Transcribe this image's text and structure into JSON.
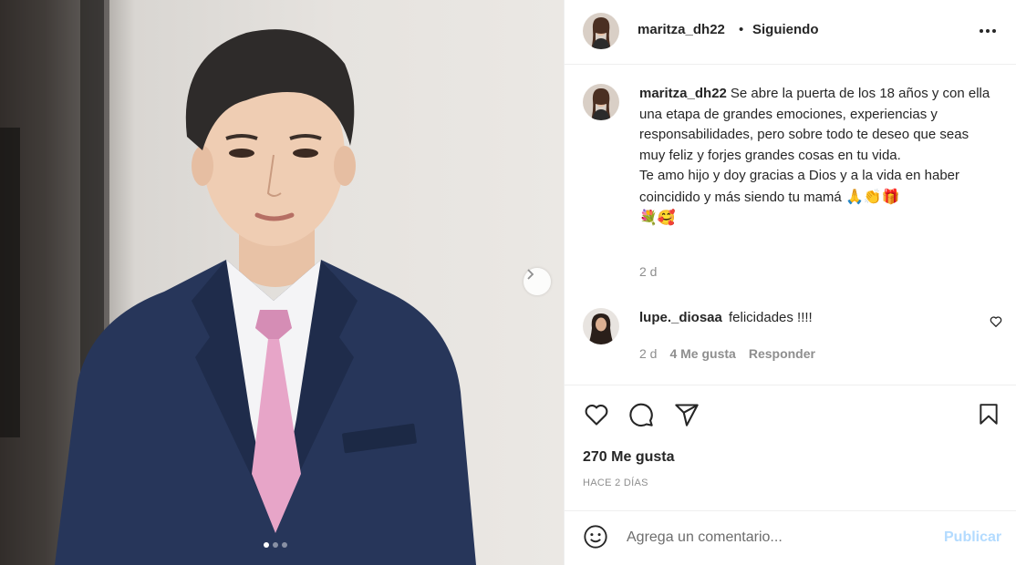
{
  "post": {
    "author": "maritza_dh22",
    "separator": "•",
    "follow_status": "Siguiendo",
    "more_icon": "more-horizontal-icon",
    "carousel": {
      "total_slides": 3,
      "active_slide": 1
    }
  },
  "caption": {
    "username": "maritza_dh22",
    "text": "Se abre la puerta de los 18 años y con ella una etapa de grandes emociones, experiencias y responsabilidades, pero sobre todo te deseo que seas muy feliz y forjes grandes cosas en tu vida.",
    "text2": "Te amo hijo y doy gracias a Dios y a la vida en haber coincidido y más siendo tu mamá",
    "emojis_line1": "🙏👏🎁",
    "emojis_line2": "💐🥰",
    "time": "2 d"
  },
  "comment": {
    "username": "lupe._diosaa",
    "text": "felicidades !!!!",
    "time": "2 d",
    "likes": "4 Me gusta",
    "reply_label": "Responder"
  },
  "actions": {
    "icons": [
      "heart-icon",
      "comment-icon",
      "share-icon",
      "bookmark-icon"
    ],
    "likes_count": "270 Me gusta",
    "date": "HACE 2 DÍAS"
  },
  "composer": {
    "placeholder": "Agrega un comentario...",
    "publish_label": "Publicar",
    "publish_color": "#b3dbff"
  }
}
